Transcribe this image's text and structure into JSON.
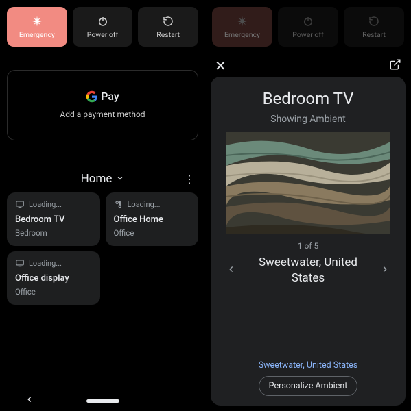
{
  "power": {
    "emergency": "Emergency",
    "poweroff": "Power off",
    "restart": "Restart"
  },
  "gpay": {
    "brand": "Pay",
    "sub": "Add a payment method"
  },
  "home": {
    "title": "Home",
    "loading": "Loading...",
    "tiles": [
      {
        "name": "Bedroom TV",
        "room": "Bedroom"
      },
      {
        "name": "Office Home",
        "room": "Office"
      },
      {
        "name": "Office display",
        "room": "Office"
      }
    ]
  },
  "detail": {
    "title": "Bedroom TV",
    "status": "Showing Ambient",
    "counter": "1 of 5",
    "caption": "Sweetwater, United States",
    "link": "Sweetwater, United States",
    "button": "Personalize Ambient"
  }
}
